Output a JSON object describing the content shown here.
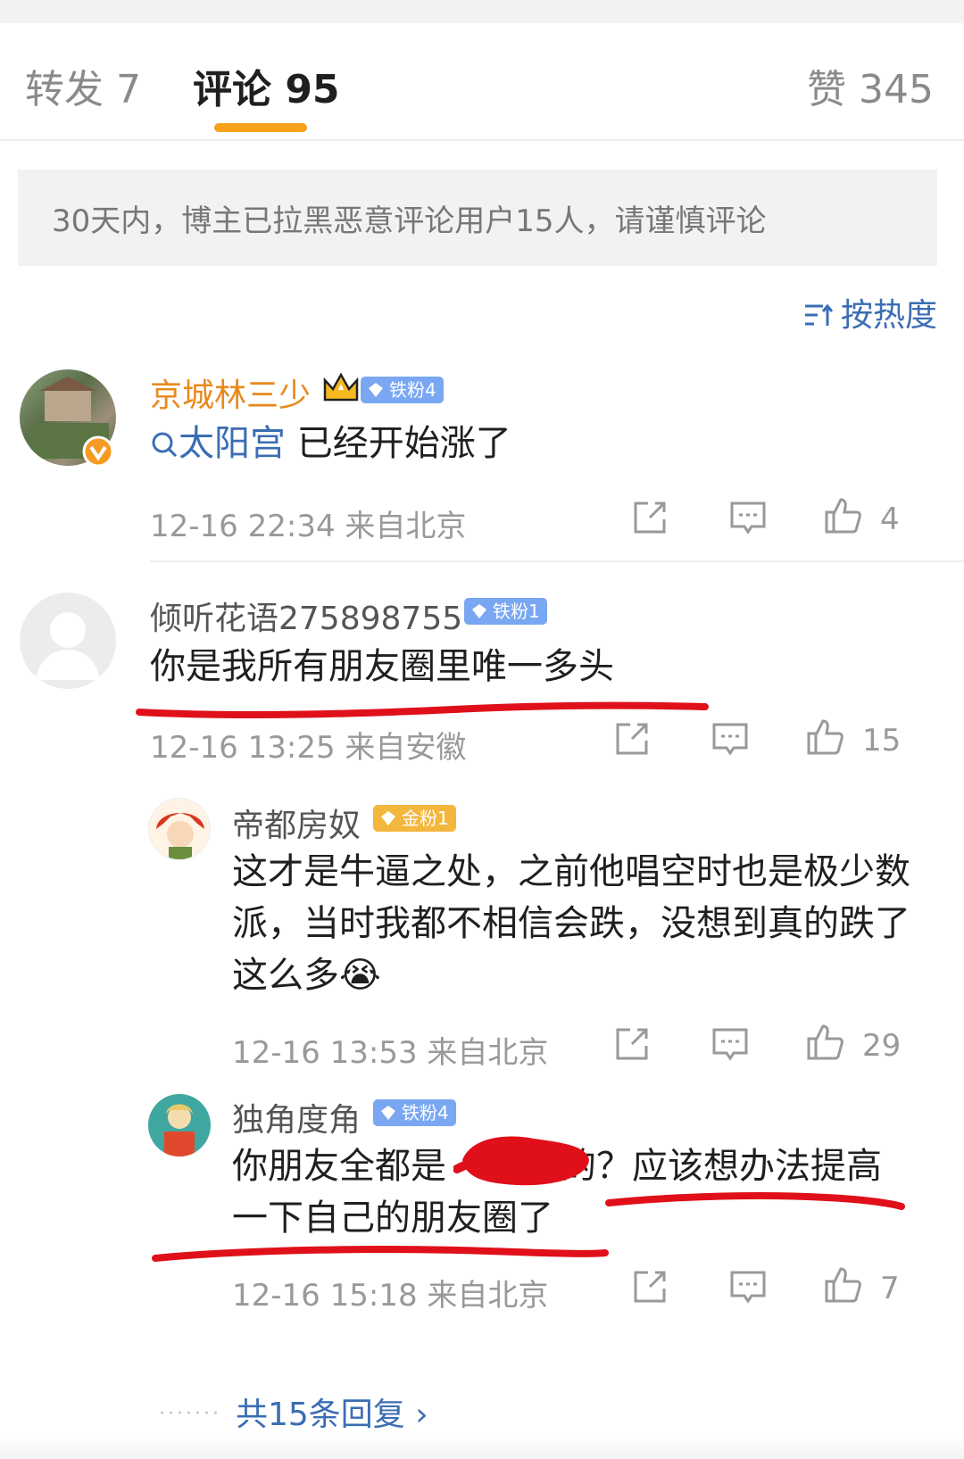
{
  "tabs": {
    "repost": "转发 7",
    "comments": "评论 95",
    "likes": "赞 345"
  },
  "notice": "30天内，博主已拉黑恶意评论用户15人，请谨慎评论",
  "sort": {
    "label": "按热度",
    "icon": "sort-icon"
  },
  "comments": [
    {
      "username": "京城林三少",
      "badge": "铁粉4",
      "topic": "太阳宫",
      "text": " 已经开始涨了",
      "time": "12-16 22:34",
      "location": "来自北京",
      "likes": "4"
    },
    {
      "username": "倾听花语275898755",
      "badge": "铁粉1",
      "text": "你是我所有朋友圈里唯一多头",
      "time": "12-16 13:25",
      "location": "来自安徽",
      "likes": "15",
      "replies": [
        {
          "username": "帝都房奴",
          "badge": "金粉1",
          "text": "这才是牛逼之处，之前他唱空时也是极少数派，当时我都不相信会跌，没想到真的跌了这么多",
          "emoji": "😭",
          "time": "12-16 13:53",
          "location": "来自北京",
          "likes": "29"
        },
        {
          "username": "独角度角",
          "badge": "铁粉4",
          "text_a": "你朋友全都是",
          "text_b": "的？应该想办法提高一下自己的朋友圈了",
          "time": "12-16 15:18",
          "location": "来自北京",
          "likes": "7"
        }
      ],
      "more_replies": "共15条回复 ›"
    }
  ],
  "colors": {
    "accent_orange": "#f7a21a",
    "link_blue": "#3b6db3",
    "username_orange": "#e8891c",
    "annotation_red": "#e0101a"
  }
}
